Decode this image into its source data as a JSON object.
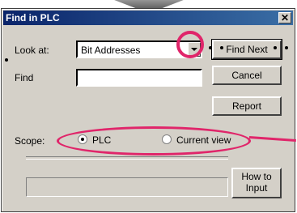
{
  "dialog": {
    "title": "Find in PLC",
    "close_symbol": "✕"
  },
  "fields": {
    "look_at_label": "Look at:",
    "look_at_value": "Bit Addresses",
    "find_label": "Find",
    "find_value": ""
  },
  "buttons": {
    "find_next": "Find Next",
    "cancel": "Cancel",
    "report": "Report",
    "how_to_input_line1": "How to",
    "how_to_input_line2": "Input"
  },
  "scope": {
    "label": "Scope:",
    "options": [
      {
        "label": "PLC",
        "selected": true
      },
      {
        "label": "Current view",
        "selected": false
      }
    ]
  },
  "annotations": {
    "highlight_color": "#e0256a"
  }
}
